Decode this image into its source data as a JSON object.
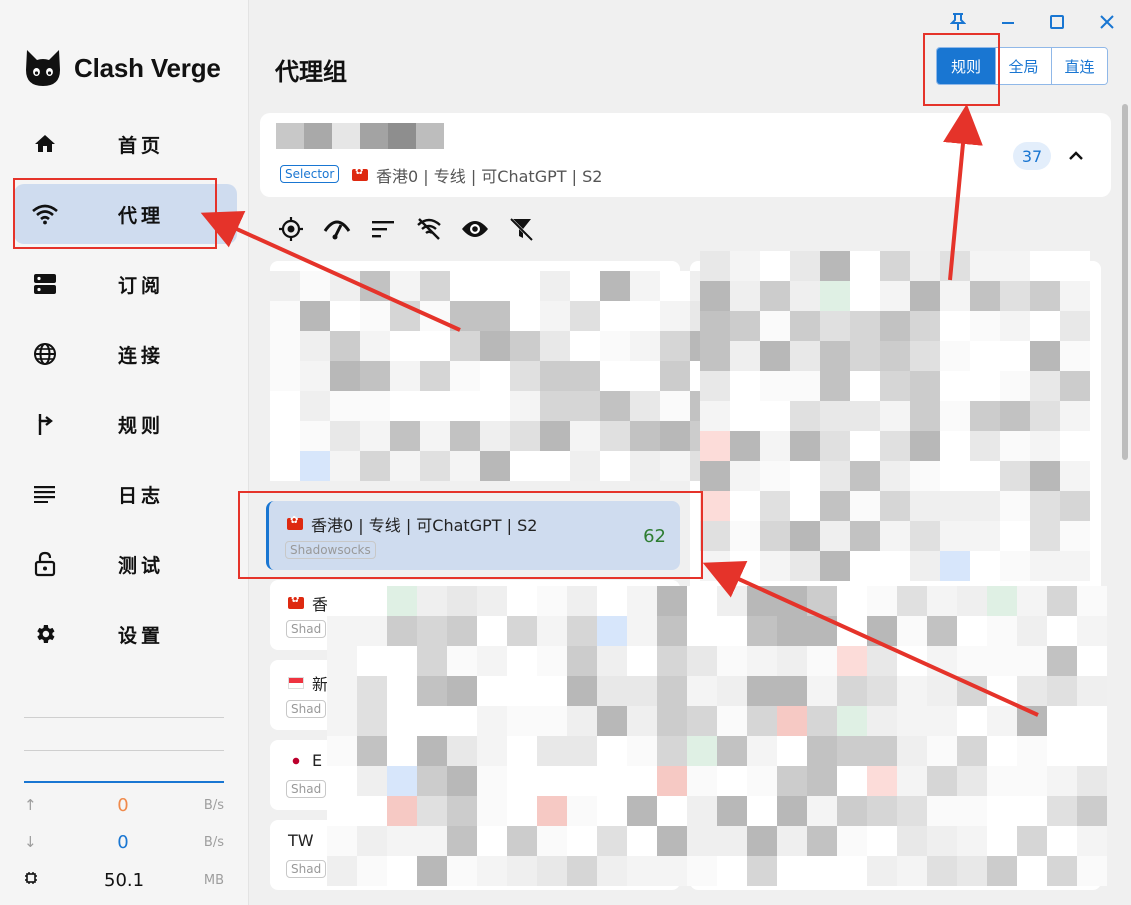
{
  "app": {
    "name": "Clash Verge"
  },
  "window_controls": {
    "pin": "pin-icon",
    "minimize": "minimize-icon",
    "maximize": "maximize-icon",
    "close": "close-icon"
  },
  "sidebar": {
    "items": [
      {
        "label": "首页",
        "icon": "home-icon"
      },
      {
        "label": "代理",
        "icon": "wifi-icon",
        "active": true
      },
      {
        "label": "订阅",
        "icon": "storage-icon"
      },
      {
        "label": "连接",
        "icon": "globe-icon"
      },
      {
        "label": "规则",
        "icon": "fork-right-icon"
      },
      {
        "label": "日志",
        "icon": "list-icon"
      },
      {
        "label": "测试",
        "icon": "lock-open-icon"
      },
      {
        "label": "设置",
        "icon": "gear-icon"
      }
    ],
    "traffic": {
      "upload": {
        "value": "0",
        "unit": "B/s"
      },
      "download": {
        "value": "0",
        "unit": "B/s"
      },
      "memory": {
        "value": "50.1",
        "unit": "MB"
      }
    }
  },
  "header": {
    "title": "代理组",
    "modes": [
      {
        "label": "规则",
        "active": true
      },
      {
        "label": "全局",
        "active": false
      },
      {
        "label": "直连",
        "active": false
      }
    ]
  },
  "group": {
    "type_tag": "Selector",
    "current": "香港0 | 专线 | 可ChatGPT | S2",
    "count": "37"
  },
  "toolbar": [
    "locate-icon",
    "speed-test-icon",
    "sort-icon",
    "wifi-off-icon",
    "eye-icon",
    "filter-off-icon"
  ],
  "selected_proxy": {
    "name": "香港0 | 专线 | 可ChatGPT | S2",
    "type": "Shadowsocks",
    "delay": "62"
  },
  "partial_proxies": [
    {
      "name": "香",
      "type": "Shad"
    },
    {
      "name": "新",
      "type": "Shad"
    },
    {
      "name": "E",
      "type": "Shad"
    },
    {
      "name": "TW",
      "type": "Shad"
    }
  ],
  "colors": {
    "accent": "#1976d2",
    "annotation": "#e5332a",
    "selected_bg": "#cfdcef",
    "delay_good": "#2e7d32"
  }
}
